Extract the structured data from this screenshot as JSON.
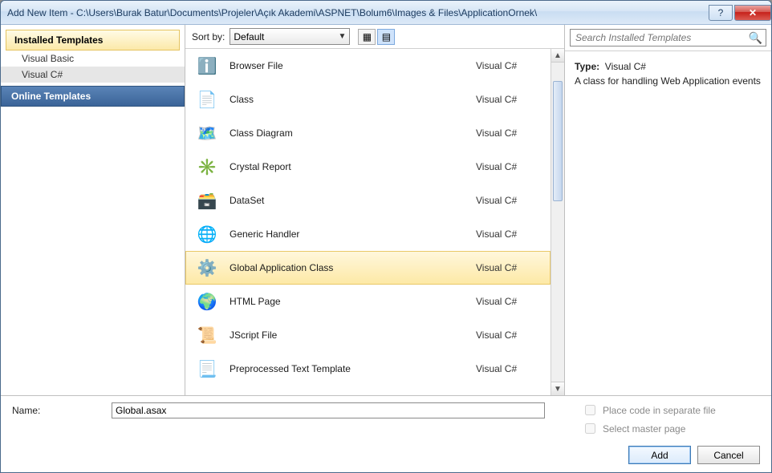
{
  "title": "Add New Item - C:\\Users\\Burak Batur\\Documents\\Projeler\\Açık Akademi\\ASPNET\\Bolum6\\Images & Files\\ApplicationOrnek\\",
  "left": {
    "installed_header": "Installed Templates",
    "items": [
      "Visual Basic",
      "Visual C#"
    ],
    "selected": 1,
    "online_header": "Online Templates"
  },
  "toolbar": {
    "sort_label": "Sort by:",
    "sort_value": "Default"
  },
  "templates": [
    {
      "name": "Browser File",
      "lang": "Visual C#",
      "icon": "ℹ️",
      "sel": false
    },
    {
      "name": "Class",
      "lang": "Visual C#",
      "icon": "📄",
      "sel": false
    },
    {
      "name": "Class Diagram",
      "lang": "Visual C#",
      "icon": "🗺️",
      "sel": false
    },
    {
      "name": "Crystal Report",
      "lang": "Visual C#",
      "icon": "✳️",
      "sel": false
    },
    {
      "name": "DataSet",
      "lang": "Visual C#",
      "icon": "🗃️",
      "sel": false
    },
    {
      "name": "Generic Handler",
      "lang": "Visual C#",
      "icon": "🌐",
      "sel": false
    },
    {
      "name": "Global Application Class",
      "lang": "Visual C#",
      "icon": "⚙️",
      "sel": true
    },
    {
      "name": "HTML Page",
      "lang": "Visual C#",
      "icon": "🌍",
      "sel": false
    },
    {
      "name": "JScript File",
      "lang": "Visual C#",
      "icon": "📜",
      "sel": false
    },
    {
      "name": "Preprocessed Text Template",
      "lang": "Visual C#",
      "icon": "📃",
      "sel": false
    }
  ],
  "search": {
    "placeholder": "Search Installed Templates"
  },
  "details": {
    "type_label": "Type:",
    "type_value": "Visual C#",
    "description": "A class for handling Web Application events"
  },
  "bottom": {
    "name_label": "Name:",
    "name_value": "Global.asax",
    "chk_separate": "Place code in separate file",
    "chk_master": "Select master page",
    "add": "Add",
    "cancel": "Cancel"
  }
}
